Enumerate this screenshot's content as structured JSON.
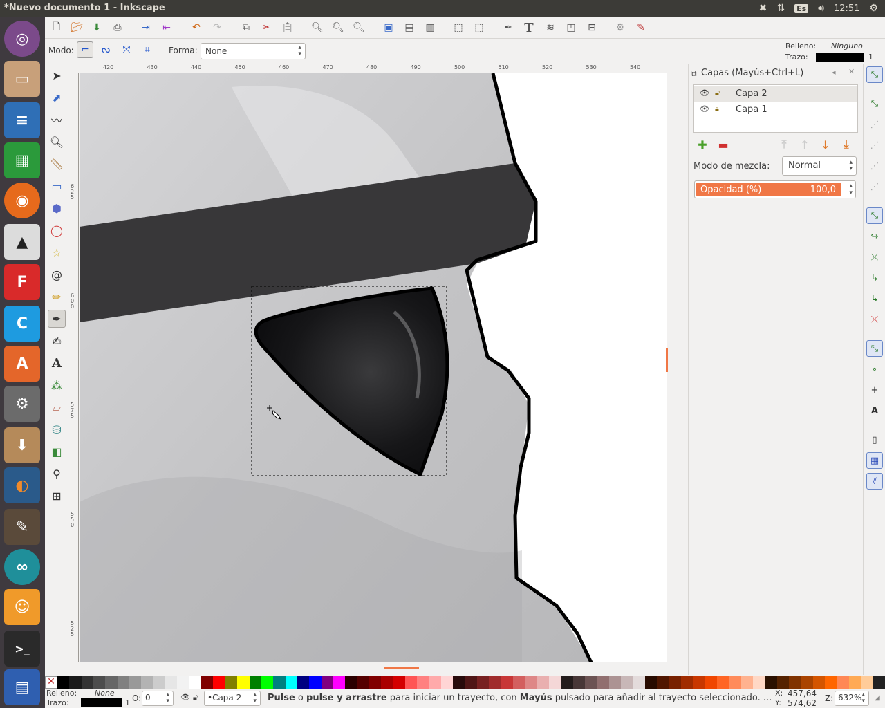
{
  "window": {
    "title": "*Nuevo documento 1 - Inkscape"
  },
  "tray": {
    "keyboard": "Es",
    "clock": "12:51"
  },
  "tool_controls": {
    "mode_label": "Modo:",
    "shape_label": "Forma:",
    "shape_value": "None",
    "fill_label": "Relleno:",
    "fill_value": "Ninguno",
    "stroke_label": "Trazo:",
    "stroke_width": "1"
  },
  "rulers": {
    "horizontal": [
      "420",
      "430",
      "440",
      "450",
      "460",
      "470",
      "480",
      "490",
      "500",
      "510",
      "520",
      "530",
      "540"
    ],
    "vertical": [
      "625",
      "600",
      "575",
      "550",
      "525"
    ]
  },
  "layers_panel": {
    "title": "Capas (Mayús+Ctrl+L)",
    "layers": [
      {
        "name": "Capa 2",
        "selected": true
      },
      {
        "name": "Capa 1",
        "selected": false
      }
    ],
    "blend_label": "Modo de mezcla:",
    "blend_value": "Normal",
    "opacity_label": "Opacidad (%)",
    "opacity_value": "100,0",
    "opacity_fraction": 1.0
  },
  "statusbar": {
    "fill_label": "Relleno:",
    "fill_value": "None",
    "stroke_label": "Trazo:",
    "stroke_width": "1",
    "opacity_label": "O:",
    "opacity_value": "0",
    "layer_value": "•Capa 2",
    "message_parts": [
      {
        "text": "Pulse",
        "bold": true
      },
      {
        "text": " o ",
        "bold": false
      },
      {
        "text": "pulse y arrastre",
        "bold": true
      },
      {
        "text": " para iniciar un trayecto, con ",
        "bold": false
      },
      {
        "text": "Mayús",
        "bold": true
      },
      {
        "text": " pulsado para añadir al trayecto seleccionado. ...",
        "bold": false
      }
    ],
    "x_label": "X:",
    "x_value": "457,64",
    "y_label": "Y:",
    "y_value": "574,62",
    "zoom_label": "Z:",
    "zoom_value": "632%"
  },
  "icons": {
    "accent": "#f07746",
    "topbar_bg": "#3c3b37",
    "launcher_bg": "#3f3a3f"
  }
}
